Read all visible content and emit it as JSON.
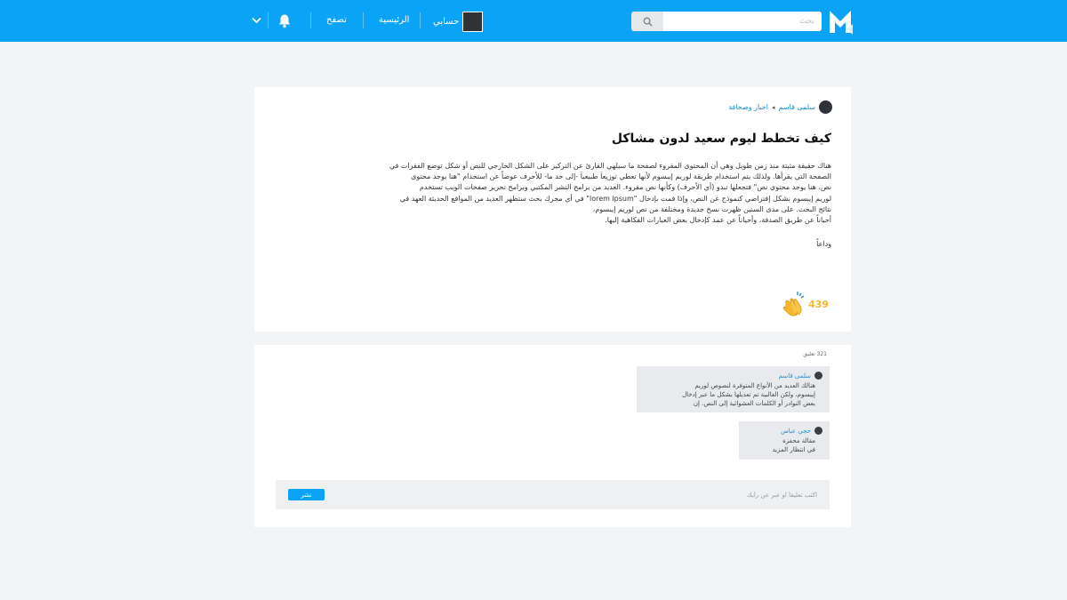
{
  "colors": {
    "brand": "#0aa3f5",
    "link": "#1a8fd4",
    "clap": "#f5b82e"
  },
  "header": {
    "logo_icon": "m-logo-icon",
    "search": {
      "placeholder": "بحث",
      "icon": "search-icon"
    },
    "nav": {
      "account_label": "حسابي",
      "home_label": "الرئيسية",
      "browse_label": "تصفح",
      "notifications_icon": "bell-icon",
      "menu_icon": "chevron-down-icon"
    }
  },
  "post": {
    "author": "سلمى قاسم",
    "category": "اخبار وصحافة",
    "title": "كيف تخطط ليوم سعيد لدون مشاكل",
    "body": [
      "هناك حقيقة مثبتة منذ زمن طويل وهي أن المحتوى المقروء لصفحة ما سيلهي القارئ عن التركيز على الشكل الخارجي للنص أو شكل توضع الفقرات في",
      "الصفحة التي يقرأها. ولذلك يتم استخدام طريقة لوريم إيبسوم لأنها تعطي توزيعاَ طبيعياَ -إلى حد ما- للأحرف عوضاً عن استخدام \"هنا يوجد محتوى",
      "نص، هنا يوجد محتوى نص\" فتجعلها تبدو (أي الأحرف) وكأنها نص مقروء. العديد من برامح النشر المكتبي وبرامح تحرير صفحات الويب تستخدم",
      "لوريم إيبسوم بشكل إفتراضي كنموذج عن النص، وإذا قمت بإدخال \"lorem ipsum\" في أي محرك بحث ستظهر العديد من المواقع الحديثة العهد في",
      "نتائج البحث. على مدى السنين ظهرت نسخ جديدة ومختلفة من نص لوريم إيبسوم،",
      "أحياناً عن طريق الصدفة، وأحياناً عن عمد كإدخال بعض العبارات الفكاهية إليها."
    ],
    "signoff": "وداعاً",
    "claps": {
      "count": "439",
      "icon": "clap-hands-icon"
    }
  },
  "comments": {
    "count_label": "321 تعليق",
    "items": [
      {
        "author": "سلمى قاسم",
        "lines": [
          "هنالك العديد من الأنواع المتوفرة لنصوص لوريم",
          "إيبسوم، ولكن الغالبية تم تعديلها بشكل ما عبر إدخال",
          "بعض النوادر أو الكلمات العشوائية إلى النص. إن"
        ]
      },
      {
        "author": "حجي عباس",
        "lines": [
          "مقالة محفزة",
          "في انتظار المزيد"
        ]
      }
    ],
    "compose": {
      "placeholder": "اكتب تعليقاً او عبر عن رأيك",
      "submit_label": "نشر"
    }
  }
}
